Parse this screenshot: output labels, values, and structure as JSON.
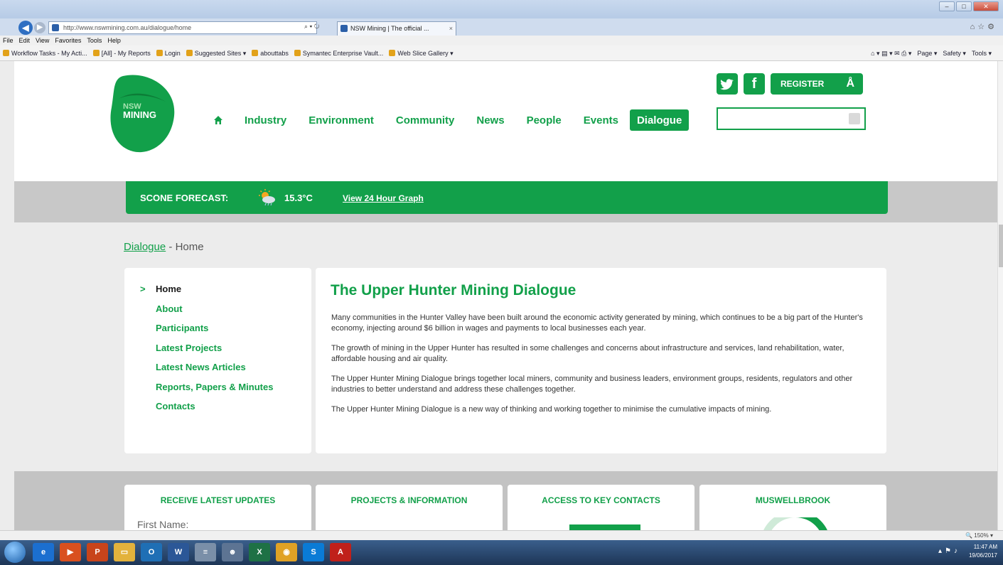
{
  "browser": {
    "address": "http://www.nswmining.com.au/dialogue/home",
    "tab_title": "NSW Mining | The official ...",
    "menu": [
      "File",
      "Edit",
      "View",
      "Favorites",
      "Tools",
      "Help"
    ],
    "favorites": [
      "Workflow Tasks - My Acti...",
      "[All] - My Reports",
      "Login",
      "Suggested Sites ▾",
      "abouttabs",
      "Symantec Enterprise Vault...",
      "Web Slice Gallery ▾"
    ],
    "commands": [
      "Page ▾",
      "Safety ▾",
      "Tools ▾"
    ],
    "zoom": "150%"
  },
  "site": {
    "logo_nsw": "NSW",
    "logo_mining": "MINING",
    "nav": [
      "Industry",
      "Environment",
      "Community",
      "News",
      "People",
      "Events",
      "Dialogue"
    ],
    "register": "REGISTER",
    "search_placeholder": ""
  },
  "forecast": {
    "label": "SCONE FORECAST:",
    "temp": "15.3°C",
    "link": "View 24 Hour Graph"
  },
  "breadcrumb": {
    "link": "Dialogue",
    "sep": " - ",
    "current": "Home"
  },
  "sidebar": {
    "items": [
      "Home",
      "About",
      "Participants",
      "Latest Projects",
      "Latest News Articles",
      "Reports, Papers & Minutes",
      "Contacts"
    ]
  },
  "main": {
    "title": "The Upper Hunter Mining Dialogue",
    "paragraphs": [
      "Many communities in the Hunter Valley have been built around the economic activity generated by mining, which continues to be a big part of the Hunter's economy, injecting around $6 billion in wages and payments to local businesses each year.",
      "The growth of mining in the Upper Hunter has resulted in some challenges and concerns about infrastructure and services, land rehabilitation, water, affordable housing and air quality.",
      "The Upper Hunter Mining Dialogue brings together local miners, community and business leaders, environment groups, residents, regulators and other industries to better understand and address these challenges together.",
      "The Upper Hunter Mining Dialogue is a new way of thinking and working together to minimise the cumulative impacts of mining."
    ]
  },
  "cards": [
    {
      "title": "RECEIVE LATEST UPDATES",
      "field": "First Name:"
    },
    {
      "title": "PROJECTS & INFORMATION"
    },
    {
      "title": "ACCESS TO KEY CONTACTS"
    },
    {
      "title": "MUSWELLBROOK"
    }
  ],
  "taskbar": {
    "time": "11:47 AM",
    "date": "19/06/2017"
  },
  "colors": {
    "brand_green": "#12a04a"
  }
}
